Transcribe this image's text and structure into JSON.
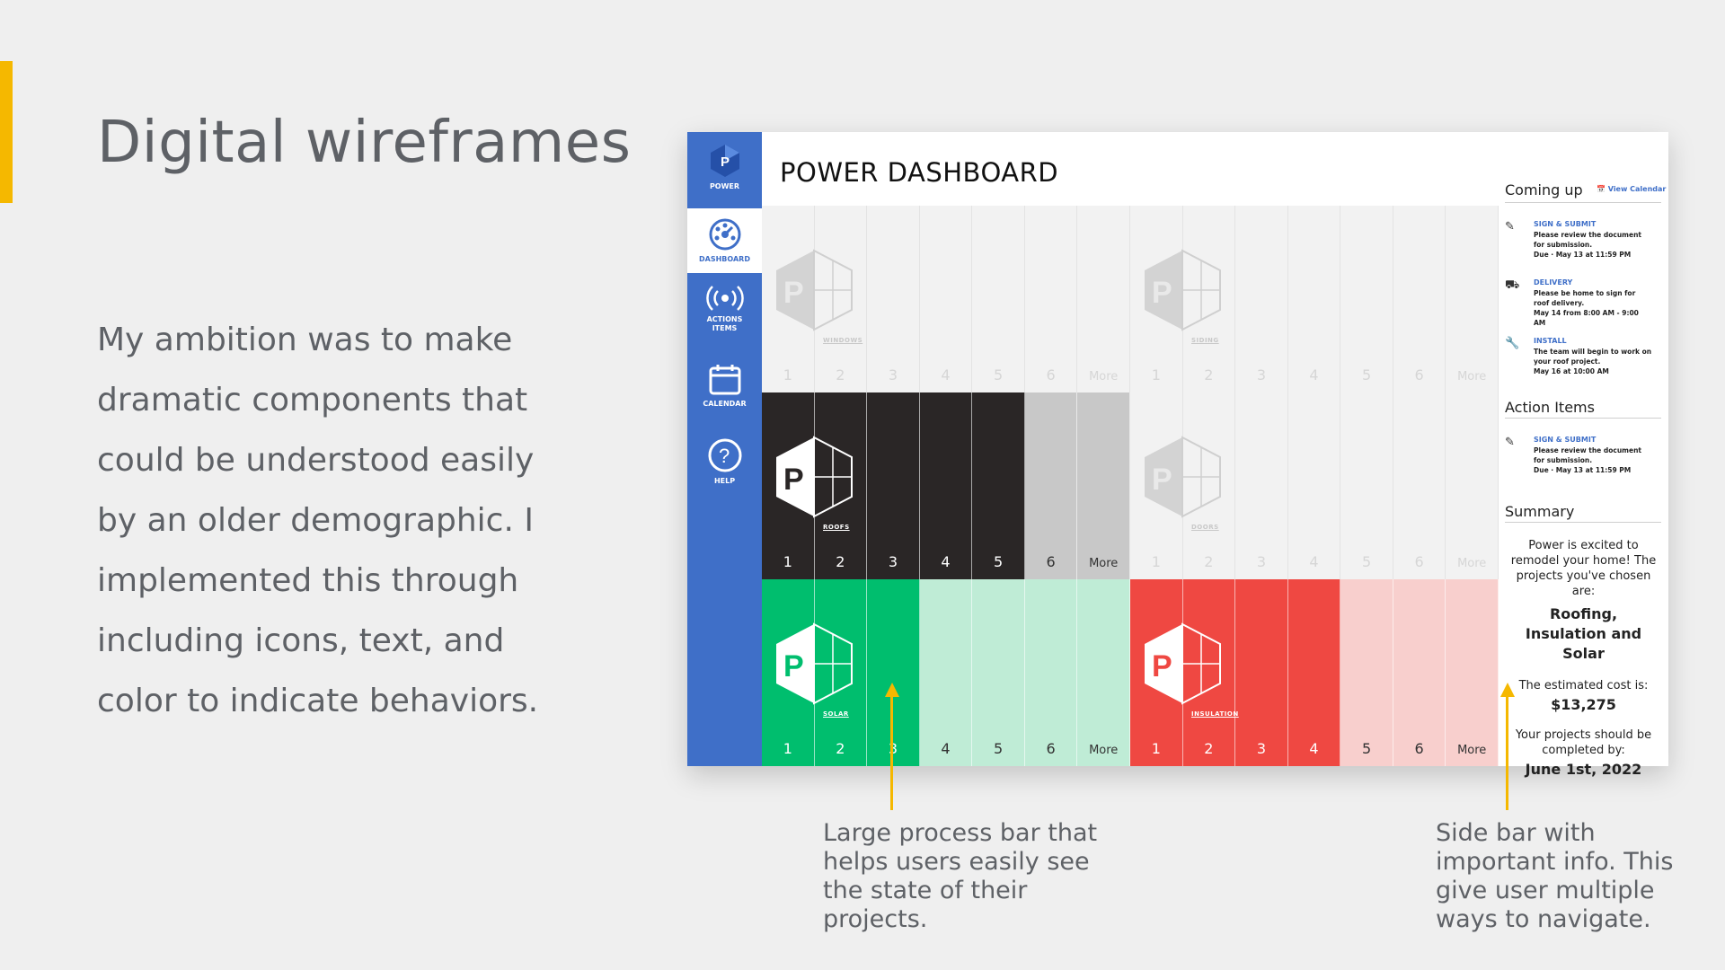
{
  "slide": {
    "title": "Digital wireframes",
    "body": "My ambition was to make dramatic components that could be understood easily by an older demographic. I implemented this through including icons, text, and color to indicate behaviors.",
    "caption_left": "Large process bar that helps users easily see the state of their projects.",
    "caption_right": "Side bar with important info. This give user multiple ways to navigate.",
    "colors": {
      "accent": "#f5b800",
      "nav": "#3f6fc8"
    }
  },
  "nav": {
    "logo_label": "POWER",
    "items": [
      {
        "label": "DASHBOARD",
        "icon": "gauge-icon"
      },
      {
        "label": "ACTIONS ITEMS",
        "icon": "broadcast-icon"
      },
      {
        "label": "CALENDAR",
        "icon": "calendar-icon"
      },
      {
        "label": "HELP",
        "icon": "help-icon"
      }
    ]
  },
  "dashboard": {
    "title": "POWER DASHBOARD",
    "step_labels": [
      "1",
      "2",
      "3",
      "4",
      "5",
      "6",
      "More"
    ],
    "projects": [
      {
        "name": "WINDOWS",
        "state": "inactive",
        "completed_steps": 0
      },
      {
        "name": "SIDING",
        "state": "inactive",
        "completed_steps": 0
      },
      {
        "name": "ROOFS",
        "state": "active",
        "completed_steps": 5
      },
      {
        "name": "DOORS",
        "state": "inactive",
        "completed_steps": 0
      },
      {
        "name": "SOLAR",
        "state": "active",
        "completed_steps": 3
      },
      {
        "name": "INSULATION",
        "state": "active",
        "completed_steps": 4
      }
    ]
  },
  "sidebar": {
    "coming_up_heading": "Coming up",
    "view_calendar": "View Calendar",
    "coming_up": [
      {
        "icon": "edit-icon",
        "title": "SIGN & SUBMIT",
        "body": "Please review the document for submission.",
        "due": "Due · May 13 at 11:59 PM"
      },
      {
        "icon": "truck-icon",
        "title": "DELIVERY",
        "body": "Please be home to sign for roof delivery.",
        "due": "May 14 from 8:00 AM - 9:00 AM"
      },
      {
        "icon": "wrench-icon",
        "title": "INSTALL",
        "body": "The team will begin to work on your roof project.",
        "due": "May 16 at 10:00 AM"
      }
    ],
    "action_items_heading": "Action Items",
    "action_items": [
      {
        "icon": "edit-icon",
        "title": "SIGN & SUBMIT",
        "body": "Please review the document for submission.",
        "due": "Due · May 13 at 11:59 PM"
      }
    ],
    "summary_heading": "Summary",
    "summary": {
      "intro": "Power is excited to remodel your home! The projects you've chosen are:",
      "projects": "Roofing, Insulation and Solar",
      "cost_label": "The estimated cost is:",
      "cost": "$13,275",
      "completion_label": "Your projects should be completed by:",
      "completion_date": "June 1st, 2022"
    }
  }
}
